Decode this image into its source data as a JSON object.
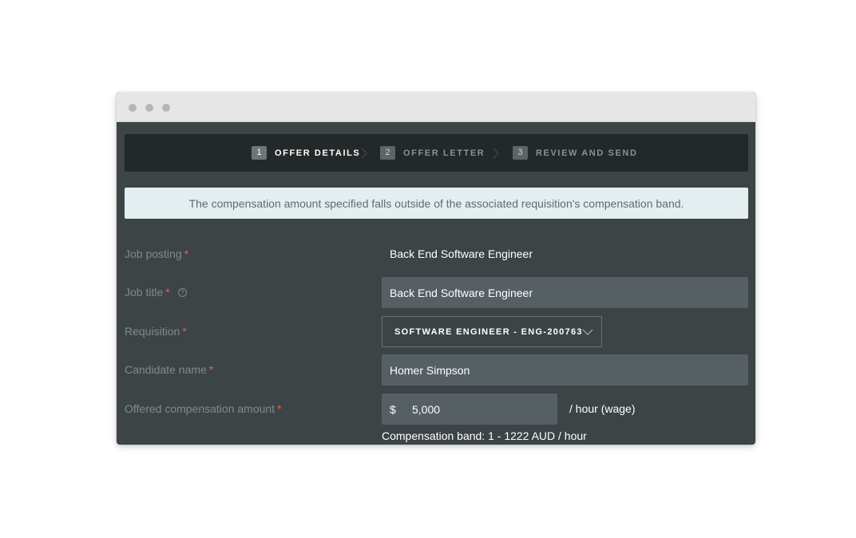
{
  "stepper": {
    "steps": [
      {
        "number": "1",
        "label": "OFFER DETAILS",
        "active": true
      },
      {
        "number": "2",
        "label": "OFFER LETTER",
        "active": false
      },
      {
        "number": "3",
        "label": "REVIEW AND SEND",
        "active": false
      }
    ]
  },
  "alert": {
    "message": "The compensation amount specified falls outside of the associated requisition's compensation band."
  },
  "form": {
    "job_posting": {
      "label": "Job posting",
      "required_mark": "*",
      "value": "Back End Software Engineer"
    },
    "job_title": {
      "label": "Job title",
      "required_mark": "*",
      "help_icon": "?",
      "value": "Back End Software Engineer"
    },
    "requisition": {
      "label": "Requisition",
      "required_mark": "*",
      "value": "SOFTWARE ENGINEER - ENG-200763"
    },
    "candidate_name": {
      "label": "Candidate name",
      "required_mark": "*",
      "value": "Homer Simpson"
    },
    "compensation": {
      "label": "Offered compensation amount",
      "required_mark": "*",
      "currency_symbol": "$",
      "amount": "5,000",
      "unit": "/ hour (wage)",
      "band_text": "Compensation band: 1 - 1222 AUD / hour"
    }
  },
  "colors": {
    "background": "#3c4446",
    "stepbar": "#232829",
    "input": "#566064",
    "alert_bg": "#e4eef0",
    "required": "#e0674f"
  },
  "icons": {
    "window_controls": "traffic-light-dots",
    "help": "question-circle-icon",
    "dropdown": "chevron-down-icon",
    "step_separator": "chevron-right-icon"
  }
}
